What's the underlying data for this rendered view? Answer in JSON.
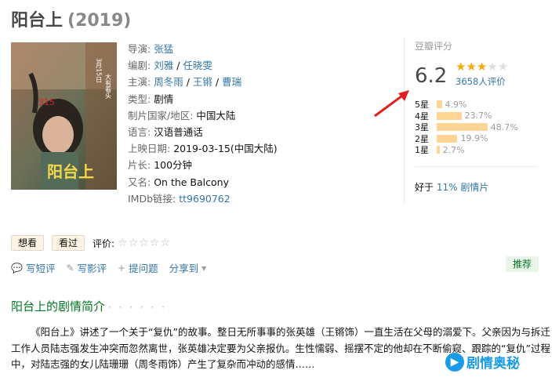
{
  "title": "阳台上",
  "year": "(2019)",
  "info": {
    "director_label": "导演:",
    "director": "张猛",
    "writer_label": "编剧:",
    "writer1": "刘雅",
    "writer_sep": " / ",
    "writer2": "任晓雯",
    "cast_label": "主演:",
    "cast1": "周冬雨",
    "cast2": "王锵",
    "cast3": "曹瑞",
    "genre_label": "类型:",
    "genre": "剧情",
    "country_label": "制片国家/地区:",
    "country": "中国大陆",
    "language_label": "语言:",
    "language": "汉语普通话",
    "release_label": "上映日期:",
    "release": "2019-03-15(中国大陆)",
    "runtime_label": "片长:",
    "runtime": "100分钟",
    "aka_label": "又名:",
    "aka": "On the Balcony",
    "imdb_label": "IMDb链接:",
    "imdb": "tt9690762"
  },
  "poster": {
    "title_text": "阳台上",
    "date_text": "3月15日",
    "slogan": "大有看头"
  },
  "rating": {
    "header": "豆瓣评分",
    "score": "6.2",
    "stars_filled": 3,
    "stars_total": 5,
    "votes": "3658人评价",
    "rows": [
      {
        "label": "5星",
        "pct": "4.9%",
        "value": 4.9
      },
      {
        "label": "4星",
        "pct": "23.7%",
        "value": 23.7
      },
      {
        "label": "3星",
        "pct": "48.7%",
        "value": 48.7
      },
      {
        "label": "2星",
        "pct": "19.9%",
        "value": 19.9
      },
      {
        "label": "1星",
        "pct": "2.7%",
        "value": 2.7
      }
    ],
    "better_prefix": "好于 ",
    "better_value": "11% 剧情片"
  },
  "actions": {
    "want": "想看",
    "seen": "看过",
    "rate_label": "评价:",
    "rate_stars": "☆☆☆☆☆"
  },
  "links": {
    "short_review": "写短评",
    "review": "写影评",
    "question": "提问题",
    "share": "分享到",
    "recommend": "推荐"
  },
  "section_title": "阳台上的剧情简介",
  "section_dots": "· · · · · ·",
  "summary": "《阳台上》讲述了一个关于“复仇”的故事。整日无所事事的张英雄（王锵饰）一直生活在父母的溺爱下。父亲因为与拆迁工作人员陆志强发生冲突而忽然离世，张英雄决定要为父亲报仇。生性懦弱、摇摆不定的他却在不断偷窥、跟踪的“复仇”过程中，对陆志强的女儿陆珊珊（周冬雨饰）产生了复杂而冲动的感情……",
  "watermark": "剧情奥秘",
  "colors": {
    "link": "#3377aa",
    "star": "#f8a80c",
    "bar": "#ffd596",
    "arrow": "#e02020",
    "section": "#007722"
  }
}
